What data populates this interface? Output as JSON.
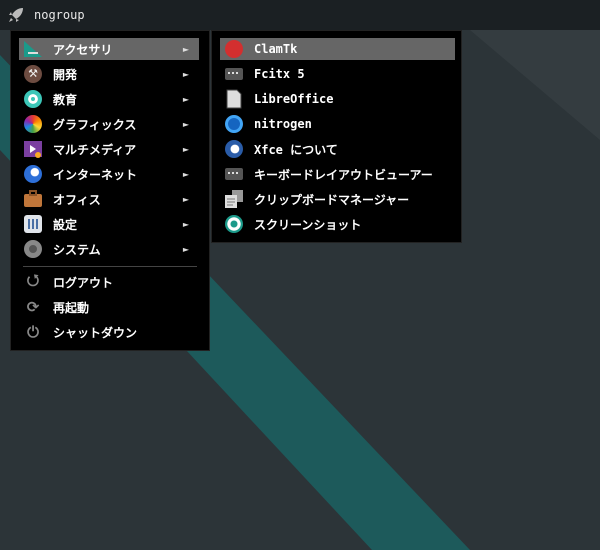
{
  "topbar": {
    "title": "nogroup"
  },
  "main_menu": [
    {
      "label": "アクセサリ",
      "icon": "accessories-icon",
      "submenu": true,
      "active": true
    },
    {
      "label": "開発",
      "icon": "development-icon",
      "submenu": true
    },
    {
      "label": "教育",
      "icon": "education-icon",
      "submenu": true
    },
    {
      "label": "グラフィックス",
      "icon": "graphics-icon",
      "submenu": true
    },
    {
      "label": "マルチメディア",
      "icon": "multimedia-icon",
      "submenu": true
    },
    {
      "label": "インターネット",
      "icon": "internet-icon",
      "submenu": true
    },
    {
      "label": "オフィス",
      "icon": "office-icon",
      "submenu": true
    },
    {
      "label": "設定",
      "icon": "settings-icon",
      "submenu": true
    },
    {
      "label": "システム",
      "icon": "system-icon",
      "submenu": true
    }
  ],
  "session": [
    {
      "label": "ログアウト",
      "icon": "logout-icon"
    },
    {
      "label": "再起動",
      "icon": "restart-icon"
    },
    {
      "label": "シャットダウン",
      "icon": "shutdown-icon"
    }
  ],
  "submenu": [
    {
      "label": "ClamTk",
      "icon": "clamtk-icon",
      "active": true
    },
    {
      "label": "Fcitx 5",
      "icon": "keyboard-icon"
    },
    {
      "label": "LibreOffice",
      "icon": "document-icon"
    },
    {
      "label": "nitrogen",
      "icon": "nitrogen-icon"
    },
    {
      "label": "Xfce について",
      "icon": "xfce-icon"
    },
    {
      "label": "キーボードレイアウトビューアー",
      "icon": "keyboard-icon"
    },
    {
      "label": "クリップボードマネージャー",
      "icon": "clipboard-icon"
    },
    {
      "label": "スクリーンショット",
      "icon": "screenshot-icon"
    }
  ],
  "arrow": "►",
  "colors": {
    "accent_teal": "#1e5c5c",
    "highlight": "#666666",
    "menu_bg": "#000000"
  }
}
